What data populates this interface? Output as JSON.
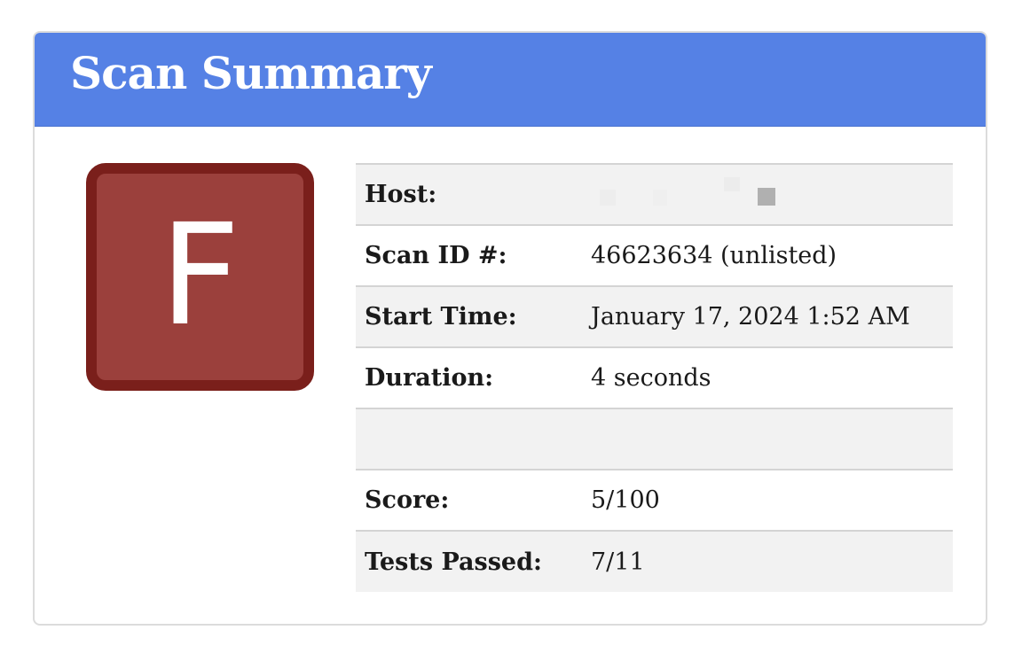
{
  "header": {
    "title": "Scan Summary",
    "color": "#5581e5"
  },
  "grade": {
    "letter": "F",
    "color": "#9b403c",
    "border_color": "#7a1f1b"
  },
  "summary": {
    "host": {
      "label": "Host:",
      "value": ""
    },
    "scan_id": {
      "label": "Scan ID #:",
      "value": "46623634 (unlisted)"
    },
    "start_time": {
      "label": "Start Time:",
      "value": "January 17, 2024 1:52 AM"
    },
    "duration": {
      "label": "Duration:",
      "value": "4 seconds"
    },
    "blank": {
      "label": "",
      "value": ""
    },
    "score": {
      "label": "Score:",
      "value": "5/100"
    },
    "tests_passed": {
      "label": "Tests Passed:",
      "value": "7/11"
    }
  }
}
